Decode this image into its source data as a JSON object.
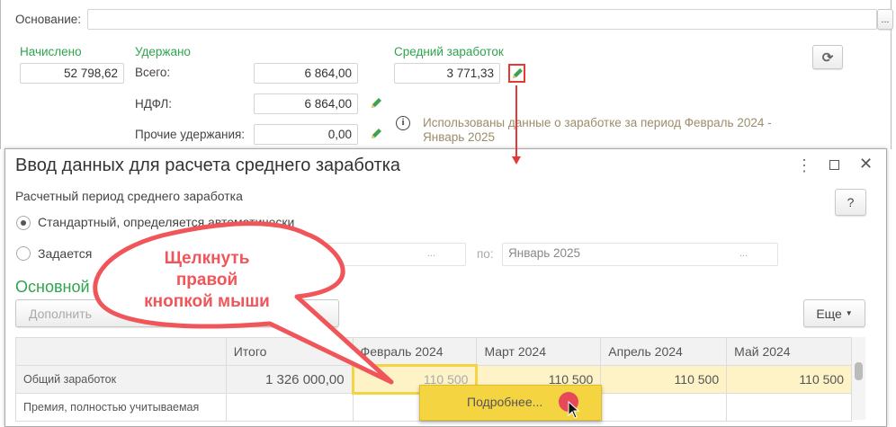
{
  "top": {
    "osnovanie_label": "Основание:",
    "osnovanie_value": "",
    "dots": "...",
    "nachisleno_label": "Начислено",
    "nachisleno_value": "52 798,62",
    "uderzhano_label": "Удержано",
    "vsego_label": "Всего:",
    "vsego_value": "6 864,00",
    "ndfl_label": "НДФЛ:",
    "ndfl_value": "6 864,00",
    "prochie_label": "Прочие удержания:",
    "prochie_value": "0,00",
    "sredniy_label": "Средний заработок",
    "sredniy_value": "3 771,33",
    "info_text": "Использованы данные о заработке за период Февраль 2024 - Январь 2025"
  },
  "dialog": {
    "title": "Ввод данных для расчета среднего заработка",
    "help": "?",
    "period_label": "Расчетный период среднего заработка",
    "radio_standard": "Стандартный, определяется автоматически",
    "radio_custom": "Задается",
    "po_label": "по:",
    "po_value": "Январь 2025",
    "dots": "...",
    "section": "Основной",
    "dopolnit": "Дополнить",
    "eshe": "Еще",
    "columns": [
      "",
      "Итого",
      "Февраль 2024",
      "Март 2024",
      "Апрель 2024",
      "Май 2024"
    ],
    "rows": [
      [
        "Общий заработок",
        "1 326 000,00",
        "110 500",
        "110 500",
        "110 500",
        "110 500"
      ],
      [
        "Премия, полностью учитываемая",
        "",
        "",
        "",
        "",
        ""
      ]
    ],
    "context_item": "Подробнее..."
  },
  "callout": {
    "line1": "Щелкнуть",
    "line2": "правой",
    "line3": "кнопкой мыши"
  },
  "colors": {
    "green": "#2ea44f",
    "red": "#f0555a",
    "yellow": "#f5d442"
  }
}
